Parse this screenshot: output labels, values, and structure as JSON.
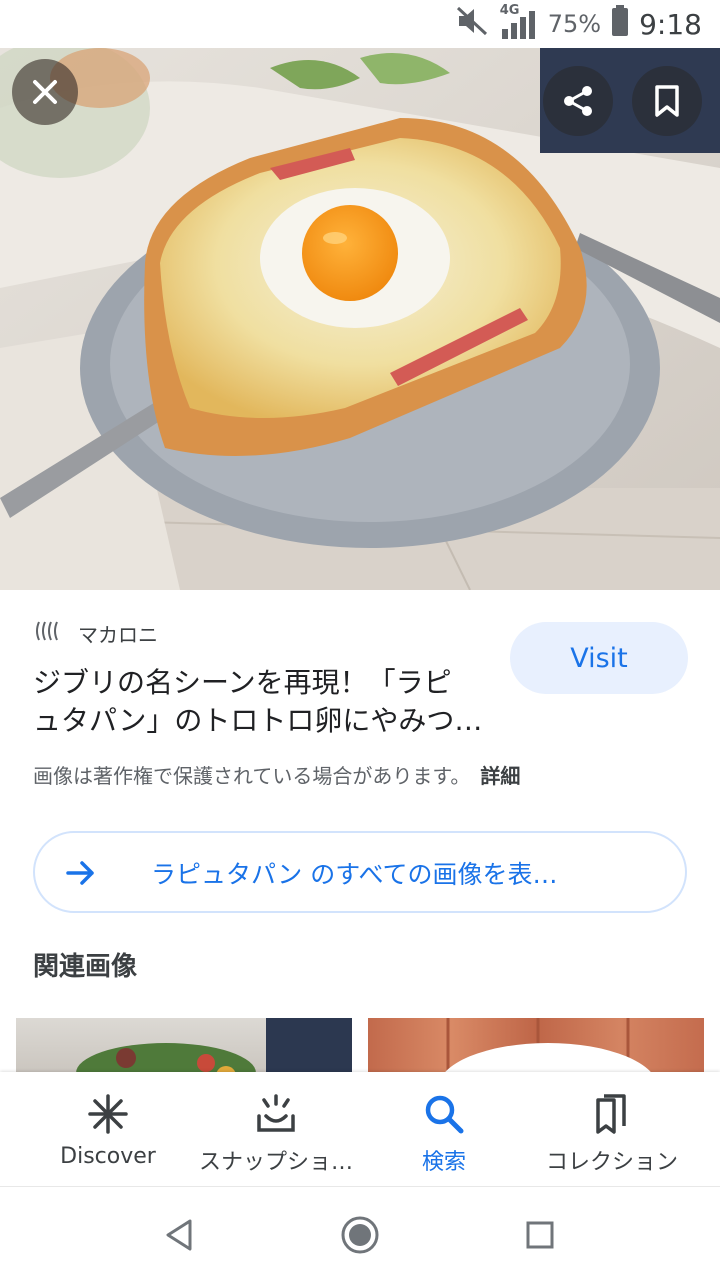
{
  "status_bar": {
    "network": "4G",
    "battery": "75%",
    "time": "9:18"
  },
  "hero": {
    "close_icon": "close-icon",
    "share_icon": "share-icon",
    "bookmark_icon": "bookmark-icon"
  },
  "result": {
    "source": "マカロニ",
    "title_line1": "ジブリの名シーンを再現！「ラピ",
    "title_line2": "ュタパン」のトロトロ卵にやみつ…",
    "visit_label": "Visit",
    "copyright_text": "画像は著作権で保護されている場合があります。",
    "details_label": "詳細"
  },
  "search_all": {
    "label": "ラピュタパン のすべての画像を表…"
  },
  "related": {
    "title": "関連画像"
  },
  "bottom_nav": {
    "items": [
      {
        "label": "Discover",
        "icon": "asterisk-icon"
      },
      {
        "label": "スナップショ…",
        "icon": "snapshot-icon"
      },
      {
        "label": "検索",
        "icon": "search-icon"
      },
      {
        "label": "コレクション",
        "icon": "collection-icon"
      }
    ],
    "active_color": "#1a73e8"
  },
  "colors": {
    "accent": "#1a73e8",
    "visit_bg": "#e8f0fe"
  }
}
